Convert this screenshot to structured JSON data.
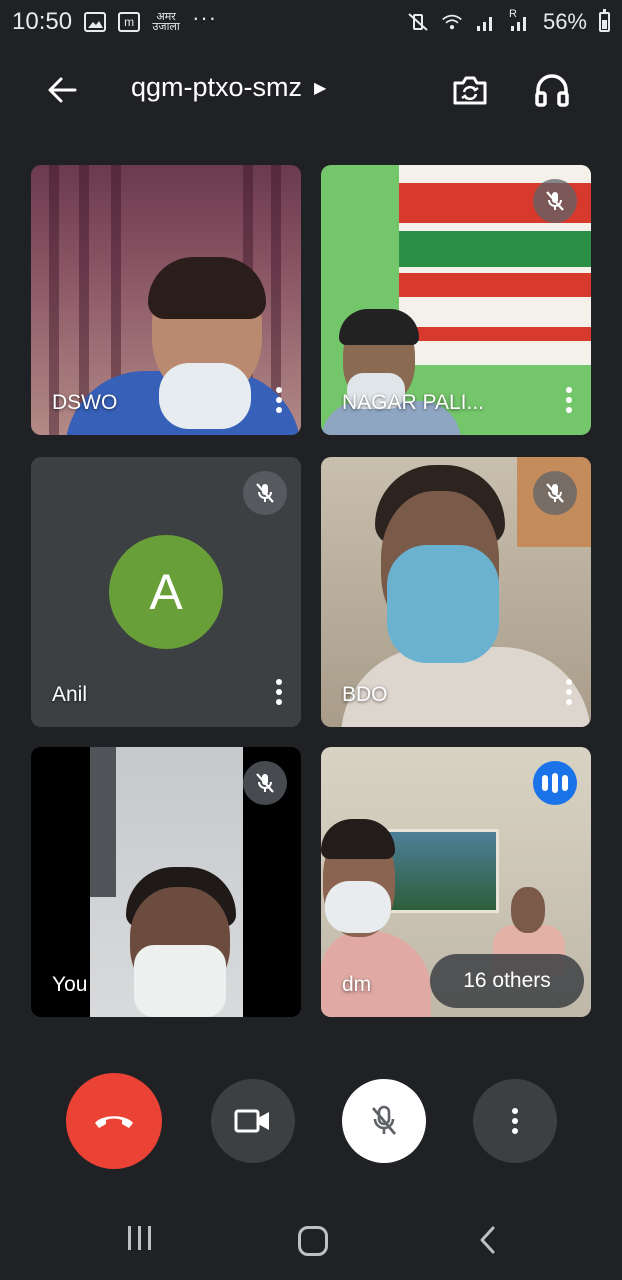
{
  "status_bar": {
    "time": "10:50",
    "app_label": "अमर उजाला",
    "m_icon": "m",
    "signal_label": "R",
    "battery": "56%"
  },
  "header": {
    "meeting_code": "qgm-ptxo-smz"
  },
  "tiles": [
    {
      "name": "DSWO",
      "muted": false
    },
    {
      "name": "NAGAR PALI...",
      "muted": true
    },
    {
      "name": "Anil",
      "muted": true,
      "avatar_letter": "A"
    },
    {
      "name": "BDO",
      "muted": true
    },
    {
      "name": "You",
      "muted": true
    },
    {
      "name": "dm",
      "speaking": true,
      "others": "16 others"
    }
  ],
  "colors": {
    "background": "#202124",
    "end_call": "#ea4335",
    "avatar": "#689f38",
    "speaking": "#1a73e8"
  },
  "icons": {
    "back": "arrow-left-icon",
    "switch_camera": "switch-camera-icon",
    "audio": "headphones-icon",
    "muted": "mic-off-icon",
    "more": "more-vert-icon",
    "end_call": "call-end-icon",
    "camera": "videocam-icon"
  }
}
